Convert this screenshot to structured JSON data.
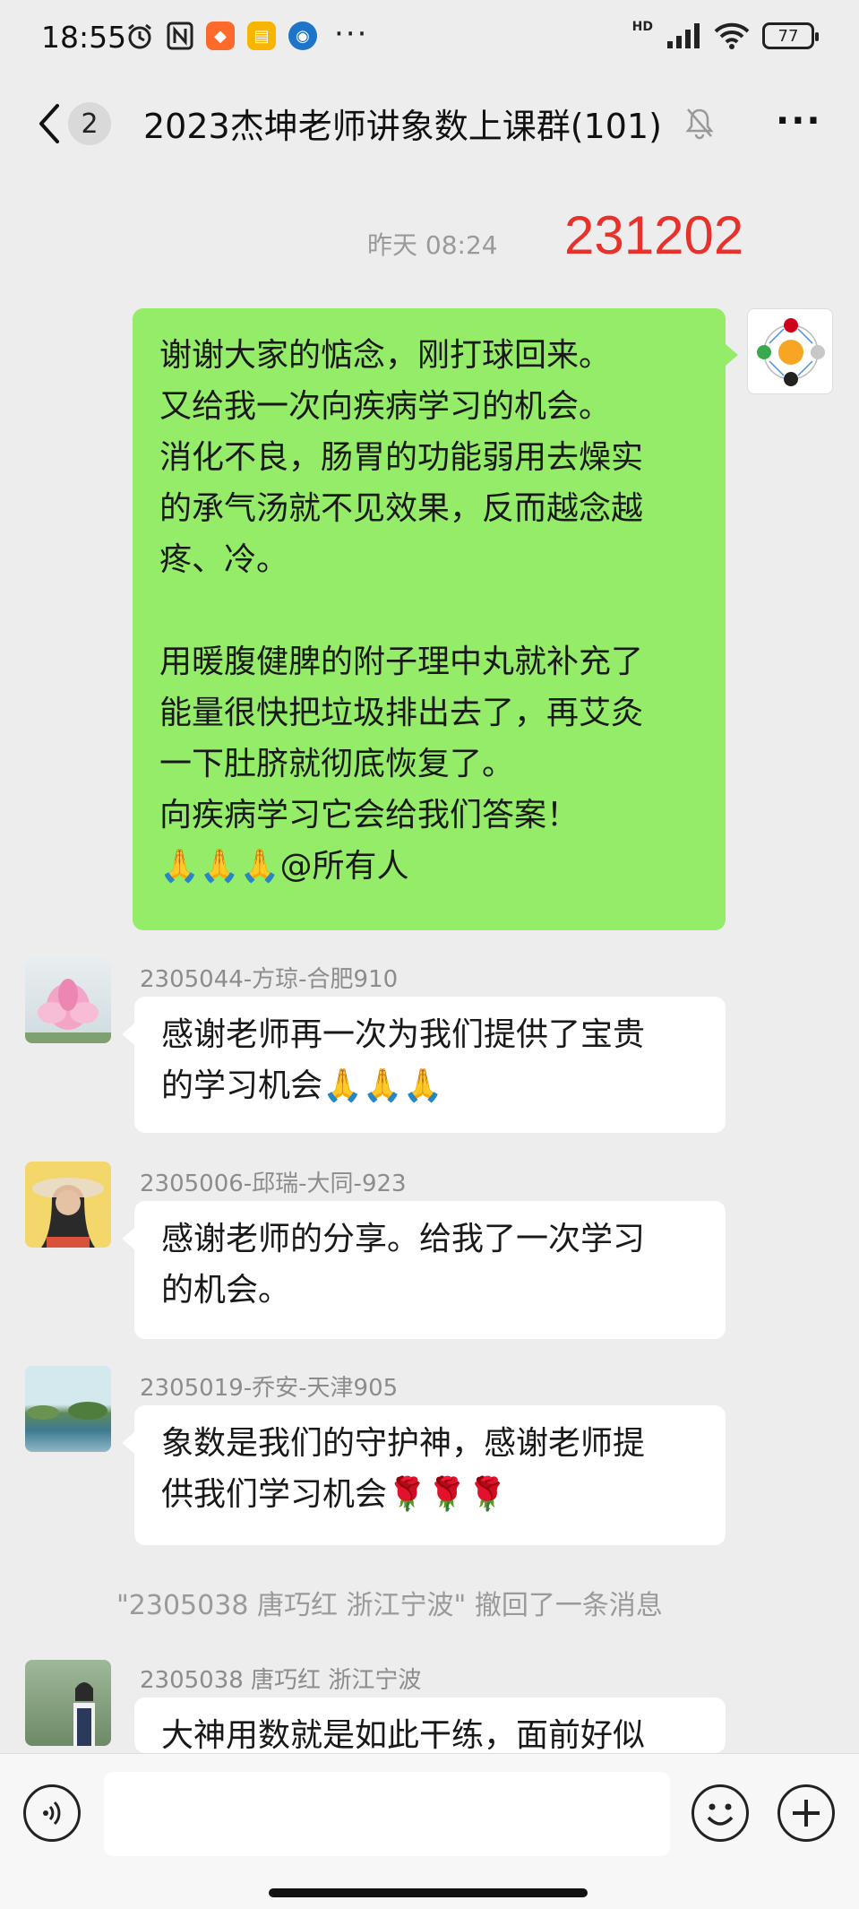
{
  "status_bar": {
    "time": "18:55",
    "dots": "···",
    "network": "HD",
    "battery": "77"
  },
  "header": {
    "unread_count": "2",
    "title": "2023杰坤老师讲象数上课群(101)"
  },
  "timeline": {
    "time_label": "昨天 08:24",
    "red_annotation": "231202"
  },
  "messages": [
    {
      "type": "self",
      "lines": [
        "谢谢大家的惦念，刚打球回来。",
        "又给我一次向疾病学习的机会。",
        "消化不良，肠胃的功能弱用去燥实",
        "的承气汤就不见效果，反而越念越",
        "疼、冷。",
        "",
        "用暖腹健脾的附子理中丸就补充了",
        "能量很快把垃圾排出去了，再艾灸",
        "一下肚脐就彻底恢复了。",
        "向疾病学习它会给我们答案！",
        "🙏🙏🙏@所有人"
      ]
    },
    {
      "type": "other",
      "sender": "2305044-方琼-合肥910",
      "lines": [
        "感谢老师再一次为我们提供了宝贵",
        "的学习机会🙏🙏🙏"
      ]
    },
    {
      "type": "other",
      "sender": "2305006-邱瑞-大同-923",
      "lines": [
        "感谢老师的分享。给我了一次学习",
        "的机会。"
      ]
    },
    {
      "type": "other",
      "sender": "2305019-乔安-天津905",
      "lines": [
        "象数是我们的守护神，感谢老师提",
        "供我们学习机会🌹🌹🌹"
      ]
    },
    {
      "type": "other",
      "sender": "2305038  唐巧红   浙江宁波",
      "lines": [
        "大神用数就是如此干练，面前好似"
      ]
    }
  ],
  "recall_note": "\"2305038  唐巧红   浙江宁波\" 撤回了一条消息",
  "colors": {
    "self_bubble": "#95ec69",
    "other_bubble": "#ffffff",
    "background": "#ededed",
    "annotation_red": "#e8312a"
  },
  "icons": [
    "back-icon",
    "mute-icon",
    "more-icon",
    "voice-icon",
    "emoji-icon",
    "plus-icon"
  ]
}
